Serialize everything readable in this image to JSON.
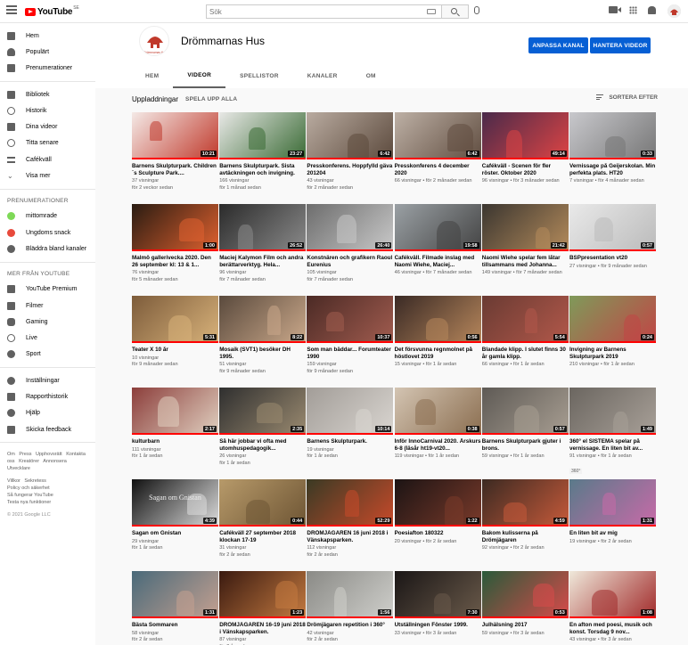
{
  "topbar": {
    "logo_text": "YouTube",
    "logo_cc": "SE",
    "search_placeholder": "Sök",
    "icons": [
      "menu-icon",
      "search-icon",
      "mic-icon",
      "create-video-icon",
      "apps-icon",
      "notifications-icon"
    ]
  },
  "sidebar": {
    "main": [
      {
        "label": "Hem",
        "icon": "home-icon"
      },
      {
        "label": "Populärt",
        "icon": "trending-icon"
      },
      {
        "label": "Prenumerationer",
        "icon": "subscriptions-icon"
      }
    ],
    "library": [
      {
        "label": "Bibliotek",
        "icon": "library-icon"
      },
      {
        "label": "Historik",
        "icon": "history-icon"
      },
      {
        "label": "Dina videor",
        "icon": "your-videos-icon"
      },
      {
        "label": "Titta senare",
        "icon": "watch-later-icon"
      },
      {
        "label": "Cafékväll",
        "icon": "playlist-icon"
      },
      {
        "label": "Visa mer",
        "icon": "chevron-down-icon"
      }
    ],
    "subs_heading": "PRENUMERATIONER",
    "subs": [
      {
        "label": "mittomrade",
        "color": "#7ed957"
      },
      {
        "label": "Ungdoms snack",
        "color": "#e84a3c"
      },
      {
        "label": "Bläddra bland kanaler",
        "color": "#606060"
      }
    ],
    "more_heading": "MER FRÅN YOUTUBE",
    "more": [
      {
        "label": "YouTube Premium",
        "icon": "youtube-premium-icon"
      },
      {
        "label": "Filmer",
        "icon": "movies-icon"
      },
      {
        "label": "Gaming",
        "icon": "gaming-icon"
      },
      {
        "label": "Live",
        "icon": "live-icon"
      },
      {
        "label": "Sport",
        "icon": "sport-icon"
      }
    ],
    "settings": [
      {
        "label": "Inställningar",
        "icon": "settings-icon"
      },
      {
        "label": "Rapporthistorik",
        "icon": "flag-icon"
      },
      {
        "label": "Hjälp",
        "icon": "help-icon"
      },
      {
        "label": "Skicka feedback",
        "icon": "feedback-icon"
      }
    ],
    "footer1": [
      "Om",
      "Press",
      "Upphovsrätt",
      "Kontakta oss",
      "Kreatörer",
      "Annonsera",
      "Utvecklare"
    ],
    "footer2": [
      "Villkor",
      "Sekretess",
      "Policy och säkerhet",
      "Så fungerar YouTube",
      "Testa nya funktioner"
    ],
    "copyright": "© 2021 Google LLC"
  },
  "channel": {
    "name": "Drömmarnas Hus",
    "avatar_caption": "Drömmarnas Hus",
    "customize_label": "ANPASSA KANAL",
    "manage_label": "HANTERA VIDEOR",
    "tabs": [
      "HEM",
      "VIDEOR",
      "SPELLISTOR",
      "KANALER",
      "OM"
    ],
    "active_tab": "VIDEOR"
  },
  "uploads": {
    "title": "Uppladdningar",
    "play_all": "SPELA UPP ALLA",
    "sort": "SORTERA EFTER"
  },
  "videos": [
    {
      "title": "Barnens Skulpturpark. Children´s Sculpture Park....",
      "views": "37 visningar",
      "age": "för 2 veckor sedan",
      "duration": "10:21",
      "color": "#f4e9e6",
      "accent": "#c0392b"
    },
    {
      "title": "Barnens Skulpturpark. Sista avtäckningen och invigning.",
      "views": "166 visningar",
      "age": "för 1 månad sedan",
      "duration": "23:27",
      "color": "#e8e8e6",
      "accent": "#3a6b35"
    },
    {
      "title": "Presskonferens. Hoppfylld gäva 201204",
      "views": "43 visningar",
      "age": "för 2 månader sedan",
      "duration": "6:42",
      "color": "#b9aba0",
      "accent": "#5c4a3d"
    },
    {
      "title": "Presskonferens 4 december 2020",
      "views": "66 visningar",
      "age": "för 2 månader sedan",
      "duration": "6:42",
      "color": "#bdb0a5",
      "accent": "#604d40"
    },
    {
      "title": "Cafékväll - Scenen för fler röster. Oktober 2020",
      "views": "96 visningar",
      "age": "för 3 månader sedan",
      "duration": "49:14",
      "color": "#4a2a4a",
      "accent": "#d44"
    },
    {
      "title": "Vernissage på Geijerskolan. Min perfekta plats. HT20",
      "views": "7 visningar",
      "age": "för 4 månader sedan",
      "duration": "0:33",
      "color": "#c8c8cc",
      "accent": "#777"
    },
    {
      "title": "Malmö gallerivecka 2020. Den 26 september kl: 13 & 1...",
      "views": "76 visningar",
      "age": "för 5 månader sedan",
      "duration": "1:00",
      "color": "#2a1c12",
      "accent": "#e0612f"
    },
    {
      "title": "Maciej Kalymon Film och andra berättarverktyg. Hela...",
      "views": "96 visningar",
      "age": "för 7 månader sedan",
      "duration": "26:52",
      "color": "#2b2b2b",
      "accent": "#8a8a8a"
    },
    {
      "title": "Konstnären och grafikern Raoul Eurenius",
      "views": "105 visningar",
      "age": "för 7 månader sedan",
      "duration": "26:40",
      "color": "#6d6d6d",
      "accent": "#c9c9c9"
    },
    {
      "title": "Cafékväll. Filmade inslag med Naomi Wiehe, Maciej...",
      "views": "46 visningar",
      "age": "för 7 månader sedan",
      "duration": "19:58",
      "color": "#9aa0a4",
      "accent": "#444"
    },
    {
      "title": "Naomi Wiehe spelar fem låtar tillsammans med Johanna...",
      "views": "149 visningar",
      "age": "för 7 månader sedan",
      "duration": "21:42",
      "color": "#3b3630",
      "accent": "#b48b5b"
    },
    {
      "title": "BSPpresentation vt20",
      "views": "27 visningar",
      "age": "för 9 månader sedan",
      "duration": "0:57",
      "color": "#e9e9e9",
      "accent": "#bbb"
    },
    {
      "title": "Teater X 10 år",
      "views": "10 visningar",
      "age": "för 9 månader sedan",
      "duration": "5:31",
      "color": "#7d5c3b",
      "accent": "#d8b27a"
    },
    {
      "title": "Mosaik (SVT1) besöker DH 1995.",
      "views": "51 visningar",
      "age": "för 9 månader sedan",
      "duration": "8:22",
      "color": "#5a4a3d",
      "accent": "#caa88a"
    },
    {
      "title": "Som man bäddar... Forumteater 1990",
      "views": "159 visningar",
      "age": "för 9 månader sedan",
      "duration": "10:37",
      "color": "#4b2a25",
      "accent": "#a15c4f"
    },
    {
      "title": "Det försvunna regnmolnet på höstlovet 2019",
      "views": "15 visningar",
      "age": "för 1 år sedan",
      "duration": "0:56",
      "color": "#3a2a25",
      "accent": "#b6865b"
    },
    {
      "title": "Blandade klipp. I slutet finns 30 år gamla klipp.",
      "views": "66 visningar",
      "age": "för 1 år sedan",
      "duration": "5:54",
      "color": "#6a3b33",
      "accent": "#b2584a"
    },
    {
      "title": "Invigning av Barnens Skulpturpark 2019",
      "views": "210 visningar",
      "age": "för 1 år sedan",
      "duration": "0:24",
      "color": "#7f9a5a",
      "accent": "#c14545"
    },
    {
      "title": "kulturbarn",
      "views": "111 visningar",
      "age": "för 1 år sedan",
      "duration": "2:17",
      "color": "#8c3e3b",
      "accent": "#e0d0c0"
    },
    {
      "title": "Så här jobbar vi ofta med utomhuspedagogik...",
      "views": "26 visningar",
      "age": "för 1 år sedan",
      "duration": "2:35",
      "color": "#2f2f2f",
      "accent": "#9a8a70"
    },
    {
      "title": "Barnens Skulpturpark.",
      "views": "19 visningar",
      "age": "för 1 år sedan",
      "duration": "10:14",
      "color": "#a29d98",
      "accent": "#d9d5d0"
    },
    {
      "title": "Inför InnoCarnival 2020. Årskurs 6-8 (läsår ht19-vt20...",
      "views": "119 visningar",
      "age": "för 1 år sedan",
      "duration": "0:38",
      "color": "#d3c4b2",
      "accent": "#8b6e50"
    },
    {
      "title": "Barnens Skulpturpark gjuter i brons.",
      "views": "59 visningar",
      "age": "för 1 år sedan",
      "duration": "0:57",
      "color": "#5e5a55",
      "accent": "#a89e92"
    },
    {
      "title": "360° el SISTEMA spelar på vernissage. En liten bit av...",
      "views": "91 visningar",
      "age": "för 1 år sedan",
      "duration": "1:49",
      "color": "#6b6660",
      "accent": "#a8a098",
      "badge": "360°"
    },
    {
      "title": "Sagan om Gnistan",
      "views": "29 visningar",
      "age": "för 1 år sedan",
      "duration": "4:39",
      "color": "#111111",
      "accent": "#dddddd",
      "overlay": "Sagan om Gnistan"
    },
    {
      "title": "Cafékväll 27 september 2018 klockan 17-19",
      "views": "31 visningar",
      "age": "för 2 år sedan",
      "duration": "0:44",
      "color": "#b79a6a",
      "accent": "#6e5534"
    },
    {
      "title": "DRÖMJÄGAREN 16 juni 2018 i Vänskapsparken.",
      "views": "112 visningar",
      "age": "för 2 år sedan",
      "duration": "52:29",
      "color": "#3a3a24",
      "accent": "#c84a2a"
    },
    {
      "title": "Poesiafton 180322",
      "views": "20 visningar",
      "age": "för 2 år sedan",
      "duration": "1:22",
      "color": "#1c1414",
      "accent": "#7a3a2a"
    },
    {
      "title": "Bakom kulisserna på Drömjägaren",
      "views": "92 visningar",
      "age": "för 2 år sedan",
      "duration": "4:59",
      "color": "#3c2a22",
      "accent": "#c65a3a"
    },
    {
      "title": "En liten bit av mig",
      "views": "19 visningar",
      "age": "för 2 år sedan",
      "duration": "1:31",
      "color": "#5a7a8a",
      "accent": "#c86aa8"
    },
    {
      "title": "Bästa Sommaren",
      "views": "58 visningar",
      "age": "för 2 år sedan",
      "duration": "1:31",
      "color": "#4a6a7a",
      "accent": "#c4a090"
    },
    {
      "title": "DRÖMJÄGAREN 16-19 juni 2018 i Vänskapsparken.",
      "views": "87 visningar",
      "age": "för 2 år sedan",
      "duration": "1:23",
      "color": "#3a1a10",
      "accent": "#c47a40"
    },
    {
      "title": "Drömjägaren repetition i 360°",
      "views": "42 visningar",
      "age": "för 2 år sedan",
      "duration": "1:56",
      "color": "#8a8a86",
      "accent": "#cfcfcb",
      "badge": "360°"
    },
    {
      "title": "Utställningen Fönster 1999.",
      "views": "33 visningar",
      "age": "för 3 år sedan",
      "duration": "7:30",
      "color": "#1a1616",
      "accent": "#6a5a4a"
    },
    {
      "title": "Julhälsning 2017",
      "views": "59 visningar",
      "age": "för 3 år sedan",
      "duration": "0:53",
      "color": "#2a5a3a",
      "accent": "#d84a4a"
    },
    {
      "title": "En afton med poesi, musik och konst. Torsdag 9 nov...",
      "views": "43 visningar",
      "age": "för 3 år sedan",
      "duration": "1:08",
      "color": "#efe8da",
      "accent": "#a12a2a"
    }
  ]
}
